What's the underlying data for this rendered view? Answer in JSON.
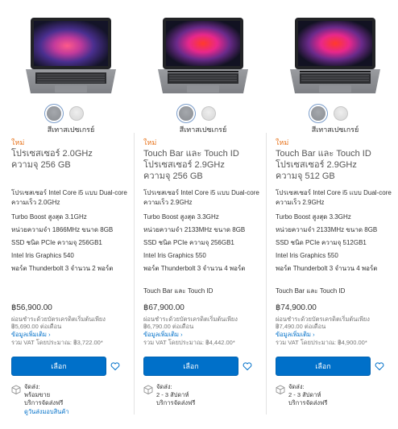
{
  "colors": {
    "accent": "#0070c9",
    "new_label": "#e87722",
    "space_gray": "#8a8d92",
    "silver": "#dcdcdc"
  },
  "products": [
    {
      "swatches": [
        "space-gray",
        "silver"
      ],
      "color_name": "สีเทาสเปซเกรย์",
      "new_label": "ใหม่",
      "title": [
        "โปรเซสเซอร์ 2.0GHz",
        "ความจุ 256 GB"
      ],
      "specs": [
        "โปรเซสเซอร์ Intel Core i5 แบบ Dual-core ความเร็ว 2.0GHz",
        "Turbo Boost สูงสุด 3.1GHz",
        "หน่วยความจำ 1866MHz ขนาด 8GB",
        "SSD ชนิด PCIe ความจุ 256GB1",
        "Intel Iris Graphics 540",
        "พอร์ต Thunderbolt 3 จำนวน 2 พอร์ต"
      ],
      "price": "฿56,900.00",
      "finance": [
        "ผ่อนชำระด้วยบัตรเครดิตเริ่มต้นเพียง",
        "฿5,690.00 ต่อเดือน"
      ],
      "more_link": "ข้อมูลเพิ่มเติม ›",
      "vat": "รวม VAT โดยประมาณ: ฿3,722.00*",
      "select_label": "เลือก",
      "ship_lines": [
        "จัดส่ง:",
        "พร้อมขาย",
        "บริการจัดส่งฟรี"
      ],
      "ship_link": "ดูวันส่งมอบสินค้า"
    },
    {
      "swatches": [
        "space-gray",
        "silver"
      ],
      "color_name": "สีเทาสเปซเกรย์",
      "new_label": "ใหม่",
      "title": [
        "Touch Bar และ Touch ID",
        "โปรเซสเซอร์ 2.9GHz",
        "ความจุ 256 GB"
      ],
      "specs": [
        "โปรเซสเซอร์ Intel Core i5 แบบ Dual-core ความเร็ว 2.9GHz",
        "Turbo Boost สูงสุด 3.3GHz",
        "หน่วยความจำ 2133MHz ขนาด 8GB",
        "SSD ชนิด PCIe ความจุ 256GB1",
        "Intel Iris Graphics 550",
        "พอร์ต Thunderbolt 3 จำนวน 4 พอร์ต",
        "Touch Bar และ Touch ID"
      ],
      "price": "฿67,900.00",
      "finance": [
        "ผ่อนชำระด้วยบัตรเครดิตเริ่มต้นเพียง",
        "฿6,790.00 ต่อเดือน"
      ],
      "more_link": "ข้อมูลเพิ่มเติม ›",
      "vat": "รวม VAT โดยประมาณ: ฿4,442.00*",
      "select_label": "เลือก",
      "ship_lines": [
        "จัดส่ง:",
        "2 - 3 สัปดาห์",
        "บริการจัดส่งฟรี"
      ],
      "ship_link": ""
    },
    {
      "swatches": [
        "space-gray",
        "silver"
      ],
      "color_name": "สีเทาสเปซเกรย์",
      "new_label": "ใหม่",
      "title": [
        "Touch Bar และ Touch ID",
        "โปรเซสเซอร์ 2.9GHz",
        "ความจุ 512 GB"
      ],
      "specs": [
        "โปรเซสเซอร์ Intel Core i5 แบบ Dual-core ความเร็ว 2.9GHz",
        "Turbo Boost สูงสุด 3.3GHz",
        "หน่วยความจำ 2133MHz ขนาด 8GB",
        "SSD ชนิด PCIe ความจุ 512GB1",
        "Intel Iris Graphics 550",
        "พอร์ต Thunderbolt 3 จำนวน 4 พอร์ต",
        "Touch Bar และ Touch ID"
      ],
      "price": "฿74,900.00",
      "finance": [
        "ผ่อนชำระด้วยบัตรเครดิตเริ่มต้นเพียง",
        "฿7,490.00 ต่อเดือน"
      ],
      "more_link": "ข้อมูลเพิ่มเติม ›",
      "vat": "รวม VAT โดยประมาณ: ฿4,900.00*",
      "select_label": "เลือก",
      "ship_lines": [
        "จัดส่ง:",
        "2 - 3 สัปดาห์",
        "บริการจัดส่งฟรี"
      ],
      "ship_link": ""
    }
  ]
}
